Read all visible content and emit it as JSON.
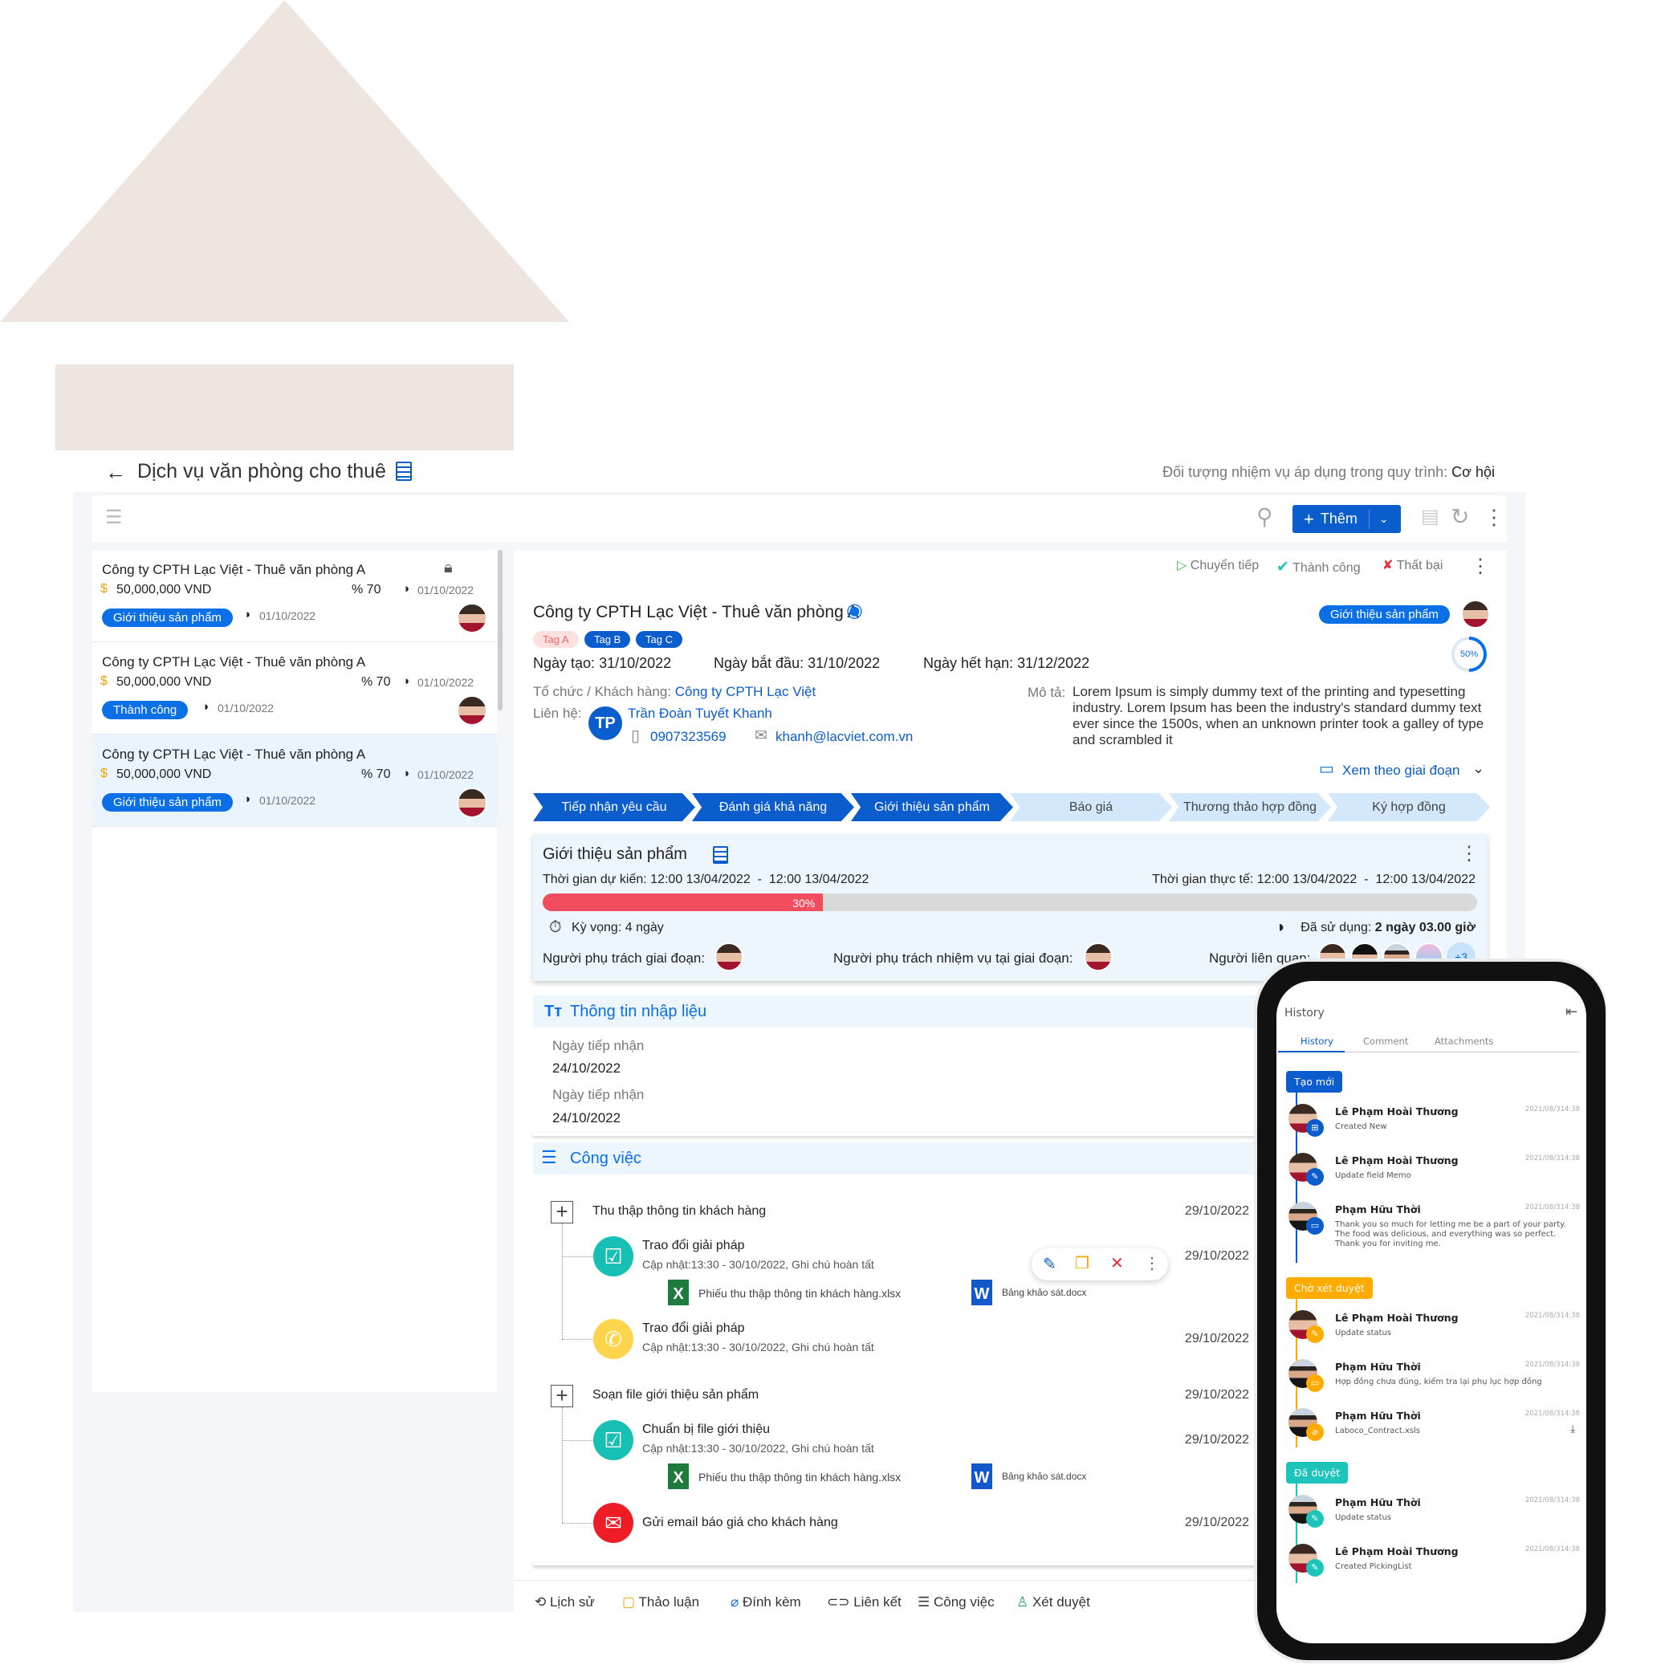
{
  "header": {
    "title": "Dịch vụ văn phòng cho thuê",
    "scope_label": "Đối tượng nhiệm vụ áp dụng trong quy trình:",
    "scope_value": "Cơ hội"
  },
  "toolbar": {
    "add_label": "Thêm"
  },
  "list": [
    {
      "title": "Công ty CPTH Lạc Việt - Thuê văn phòng A",
      "amount": "50,000,000 VND",
      "percent": "% 70",
      "date": "01/10/2022",
      "stage": "Giới thiệu sản phẩm",
      "stage_date": "01/10/2022",
      "locked": true
    },
    {
      "title": "Công ty CPTH Lạc Việt - Thuê văn phòng A",
      "amount": "50,000,000 VND",
      "percent": "% 70",
      "date": "01/10/2022",
      "stage": "Thành công",
      "stage_date": "01/10/2022"
    },
    {
      "title": "Công ty CPTH Lạc Việt - Thuê văn phòng A",
      "amount": "50,000,000 VND",
      "percent": "% 70",
      "date": "01/10/2022",
      "stage": "Giới thiệu sản phẩm",
      "stage_date": "01/10/2022",
      "selected": true
    }
  ],
  "actions": {
    "forward": "Chuyển tiếp",
    "success": "Thành công",
    "fail": "Thất bại"
  },
  "detail": {
    "title": "Công ty CPTH Lạc Việt - Thuê văn phòng A",
    "stage_badge": "Giới thiệu sản phẩm",
    "progress_ring": "50%",
    "progress_ring_value": 50,
    "tags": [
      "Tag A",
      "Tag B",
      "Tag C"
    ],
    "created_label": "Ngày tạo:",
    "created": "31/10/2022",
    "start_label": "Ngày bắt đầu:",
    "start": "31/10/2022",
    "end_label": "Ngày hết hạn:",
    "end": "31/12/2022",
    "org_label": "Tổ chức / Khách hàng:",
    "org": "Công ty CPTH Lạc Việt",
    "contact_label": "Liên hệ:",
    "contact_initials": "TP",
    "contact_name": "Trần Đoàn Tuyết Khanh",
    "phone": "0907323569",
    "email": "khanh@lacviet.com.vn",
    "desc_label": "Mô tả:",
    "desc": "Lorem Ipsum is simply dummy text of the printing and typesetting industry. Lorem Ipsum has been the industry's standard dummy text ever since the 1500s, when an unknown printer took a galley of type and scrambled it",
    "view_by": "Xem theo giai đoạn"
  },
  "stages": [
    {
      "label": "Tiếp nhận yêu cầu",
      "done": true
    },
    {
      "label": "Đánh giá khả năng",
      "done": true
    },
    {
      "label": "Giới thiệu sản phẩm",
      "done": true
    },
    {
      "label": "Báo giá",
      "done": false
    },
    {
      "label": "Thương thảo hợp đồng",
      "done": false
    },
    {
      "label": "Ký hợp đồng",
      "done": false
    }
  ],
  "stage_card": {
    "title": "Giới thiệu sản phẩm",
    "planned_label": "Thời gian dự kiến:",
    "planned": "12:00 13/04/2022  -  12:00 13/04/2022",
    "actual_label": "Thời gian thực tế:",
    "actual": "12:00 13/04/2022  -  12:00 13/04/2022",
    "progress": 30,
    "progress_label": "30%",
    "expected_label": "Kỳ vọng:",
    "expected": "4 ngày",
    "used_label": "Đã sử dụng:",
    "used": "2 ngày 03.00 giờ",
    "owner_label": "Người phụ trách giai đoạn:",
    "task_owner_label": "Người phụ trách nhiệm vụ tại giai đoạn:",
    "related_label": "Người liên quan:",
    "related_more": "+3"
  },
  "input_section": {
    "title": "Thông tin nhập liệu",
    "fields": [
      {
        "label": "Ngày tiếp nhận",
        "value": "24/10/2022"
      },
      {
        "label": "Ngày tiếp nhận",
        "value": "24/10/2022"
      }
    ]
  },
  "tasks_section": {
    "title": "Công việc"
  },
  "tasks": [
    {
      "group": "Thu thập thông tin khách hàng",
      "date": "29/10/2022",
      "items": [
        {
          "title": "Trao đổi giải pháp",
          "sub": "Cập nhật:13:30 - 30/10/2022, Ghi chú hoàn tất",
          "date": "29/10/2022",
          "icon": "check",
          "color": "#18bfb4",
          "files": [
            "Phiếu thu thập thông tin khách hàng.xlsx",
            "Bảng khảo sát.docx"
          ]
        },
        {
          "title": "Trao đổi giải pháp",
          "sub": "Cập nhật:13:30 - 30/10/2022, Ghi chú hoàn tất",
          "date": "29/10/2022",
          "icon": "phone",
          "color": "#fcd54c"
        }
      ]
    },
    {
      "group": "Soạn file giới thiệu sản phẩm",
      "date": "29/10/2022",
      "items": [
        {
          "title": "Chuẩn bị file giới thiệu",
          "sub": "Cập nhật:13:30 - 30/10/2022, Ghi chú hoàn tất",
          "date": "29/10/2022",
          "icon": "check",
          "color": "#18bfb4",
          "files": [
            "Phiếu thu thập thông tin khách hàng.xlsx",
            "Bảng khảo sát.docx"
          ]
        },
        {
          "title": "Gửi email báo giá cho khách hàng",
          "date": "29/10/2022",
          "icon": "mail",
          "color": "#ee1c25"
        }
      ]
    }
  ],
  "bottom_tabs": [
    "Lịch sử",
    "Thảo luận",
    "Đính kèm",
    "Liên kết",
    "Công việc",
    "Xét duyệt"
  ],
  "phone": {
    "title": "History",
    "tabs": [
      "History",
      "Comment",
      "Attachments"
    ],
    "phases": [
      {
        "label": "Tạo mới",
        "color": "#0b5ccc",
        "items": [
          {
            "name": "Lê Phạm Hoài Thương",
            "sub": "Created New",
            "time": "2021/08/314:38",
            "icon": "plus-box",
            "male": false
          },
          {
            "name": "Lê Phạm Hoài Thương",
            "sub": "Update field Memo",
            "time": "2021/08/314:38",
            "icon": "pencil",
            "male": false
          },
          {
            "name": "Phạm Hữu Thời",
            "sub": "Thank you so much for letting me be a part of your party. The food was delicious, and everything was so perfect. Thank you for inviting me.",
            "time": "2021/08/314:38",
            "icon": "comment",
            "male": true
          }
        ]
      },
      {
        "label": "Chờ xét duyệt",
        "color": "#ffab00",
        "items": [
          {
            "name": "Lê Phạm Hoài Thương",
            "sub": "Update status",
            "time": "2021/08/314:38",
            "icon": "pencil",
            "male": false
          },
          {
            "name": "Phạm Hữu Thời",
            "sub": "Hợp đồng chưa đúng, kiểm tra lại phụ lục hợp đồng",
            "time": "2021/08/314:38",
            "icon": "comment",
            "male": true
          },
          {
            "name": "Phạm Hữu Thời",
            "sub": "Laboco_Contract.xsls",
            "time": "2021/08/314:38",
            "icon": "paperclip",
            "male": true,
            "download": true
          }
        ]
      },
      {
        "label": "Đã duyệt",
        "color": "#1dc4b9",
        "items": [
          {
            "name": "Phạm Hữu Thời",
            "sub": "Update status",
            "time": "2021/08/314:38",
            "icon": "pencil",
            "male": true
          },
          {
            "name": "Lê Phạm Hoài Thương",
            "sub": "Created PickingList",
            "time": "2021/08/314:38",
            "icon": "pencil",
            "male": false
          }
        ]
      }
    ]
  },
  "colors": {
    "primary": "#0b5ccc",
    "badge": "#0b6fe6",
    "progress": "#f24d5e",
    "stage_pending": "#d3e8fb",
    "panel": "#eef6fd"
  }
}
